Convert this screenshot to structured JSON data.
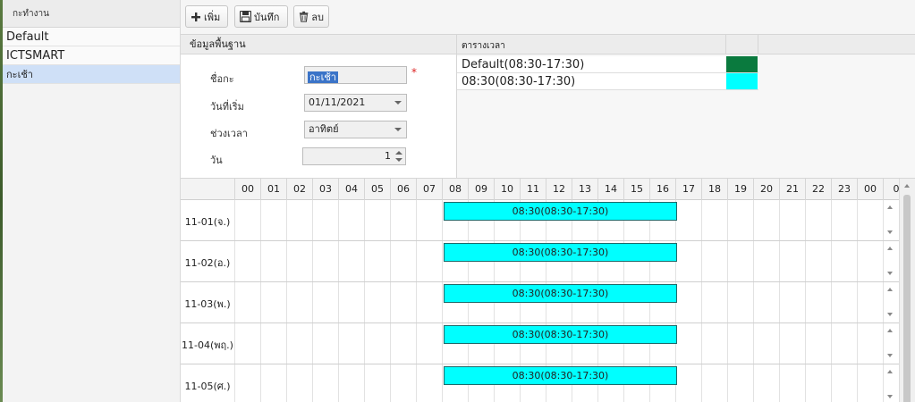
{
  "sidebar": {
    "header": "กะทำงาน",
    "items": [
      {
        "label": "Default"
      },
      {
        "label": "ICTSMART"
      },
      {
        "label": "กะเช้า"
      }
    ]
  },
  "toolbar": {
    "add_label": "เพิ่ม",
    "save_label": "บันทึก",
    "delete_label": "ลบ"
  },
  "form": {
    "title": "ข้อมูลพื้นฐาน",
    "name_label": "ชื่อกะ",
    "name_value": "กะเช้า",
    "required_mark": "*",
    "start_label": "วันที่เริ่ม",
    "start_value": "01/11/2021",
    "period_label": "ช่วงเวลา",
    "period_value": "อาทิตย์",
    "days_label": "วัน",
    "days_value": "1"
  },
  "timetable": {
    "title": "ตารางเวลา",
    "rows": [
      {
        "label": "Default(08:30-17:30)",
        "color": "#0a7a3e"
      },
      {
        "label": "08:30(08:30-17:30)",
        "color": "#00ffff"
      }
    ]
  },
  "chart_data": {
    "type": "gantt",
    "hours": [
      "00",
      "01",
      "02",
      "03",
      "04",
      "05",
      "06",
      "07",
      "08",
      "09",
      "10",
      "11",
      "12",
      "13",
      "14",
      "15",
      "16",
      "17",
      "18",
      "19",
      "20",
      "21",
      "22",
      "23",
      "00",
      "0"
    ],
    "rows": [
      {
        "day": "11-01(จ.)",
        "bars": [
          {
            "label": "08:30(08:30-17:30)",
            "start": 8.0,
            "end": 17.0
          }
        ]
      },
      {
        "day": "11-02(อ.)",
        "bars": [
          {
            "label": "08:30(08:30-17:30)",
            "start": 8.0,
            "end": 17.0
          }
        ]
      },
      {
        "day": "11-03(พ.)",
        "bars": [
          {
            "label": "08:30(08:30-17:30)",
            "start": 8.0,
            "end": 17.0
          }
        ]
      },
      {
        "day": "11-04(พฤ.)",
        "bars": [
          {
            "label": "08:30(08:30-17:30)",
            "start": 8.0,
            "end": 17.0
          }
        ]
      },
      {
        "day": "11-05(ศ.)",
        "bars": [
          {
            "label": "08:30(08:30-17:30)",
            "start": 8.0,
            "end": 17.0
          }
        ]
      }
    ],
    "bar_color": "#00ffff"
  }
}
